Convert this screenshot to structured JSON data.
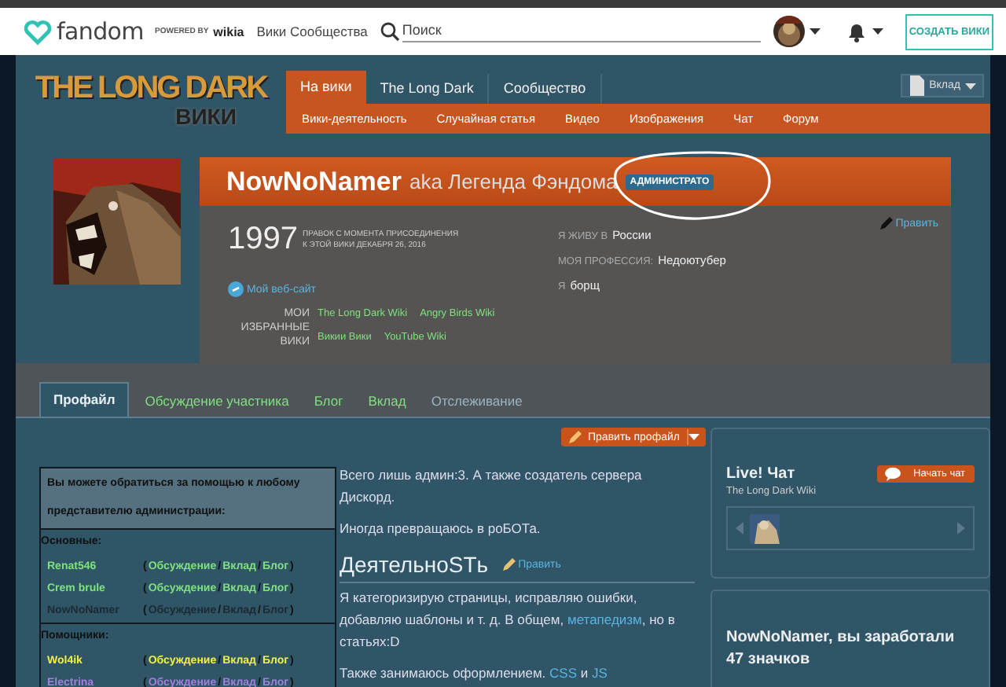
{
  "topbar": {
    "logo": "fandom",
    "powered_by": "POWERED BY",
    "wikia": "wikia",
    "community_link": "Вики Сообщества",
    "search": {
      "placeholder": "Поиск"
    },
    "create_button": "СОЗДАТЬ ВИКИ"
  },
  "wiki_header": {
    "logo_title": "THE LONG DARK",
    "logo_subtitle": "ВИКИ",
    "tabs": [
      {
        "label": "На вики",
        "selected": true
      },
      {
        "label": "The Long Dark",
        "selected": false
      },
      {
        "label": "Сообщество",
        "selected": false
      }
    ],
    "subnav": [
      "Вики-деятельность",
      "Случайная статья",
      "Видео",
      "Изображения",
      "Чат",
      "Форум"
    ],
    "contribute_button": "Вклад"
  },
  "profile": {
    "name": "NowNoNamer",
    "aka": "aka Легенда Фэндома",
    "badge": "АДМИНИСТРАТО",
    "edit_link": "Править",
    "edit_count": "1997",
    "edit_caption": [
      "ПРАВОК С МОМЕНТА ПРИСОЕДИНЕНИЯ",
      "К ЭТОЙ ВИКИ ДЕКАБРЯ 26, 2016"
    ],
    "website": "Мой веб-сайт",
    "favorites_label": "МОИ ИЗБРАННЫЕ ВИКИ",
    "favorites": [
      "The Long Dark Wiki",
      "Angry Birds Wiki",
      "Викии Вики",
      "YouTube Wiki"
    ],
    "facts": [
      {
        "label": "Я ЖИВУ В",
        "value": "России"
      },
      {
        "label": "МОЯ ПРОФЕССИЯ:",
        "value": "Недоютубер"
      },
      {
        "label": "Я",
        "value": "борщ"
      }
    ]
  },
  "tabs": [
    {
      "label": "Профайл",
      "selected": true
    },
    {
      "label": "Обсуждение участника",
      "selected": false
    },
    {
      "label": "Блог",
      "selected": false
    },
    {
      "label": "Вклад",
      "selected": false
    },
    {
      "label": "Отслеживание",
      "selected": false
    }
  ],
  "edit_profile_button": "Править профайл",
  "admin_table": {
    "header": "Вы можете обратиться за помощью к любому представителю администрации:",
    "groups": [
      {
        "title": "Основные:",
        "members": [
          {
            "name": "Renat546",
            "color": "#7ee07e",
            "parts": [
              "(",
              "Обсуждение",
              "/",
              "Вклад",
              "/",
              "Блог",
              ")"
            ]
          },
          {
            "name": "Crem brule",
            "color": "#7ee07e",
            "parts": [
              "(",
              "Обсуждение",
              "/",
              "Вклад",
              "/",
              "Блог",
              ")"
            ]
          },
          {
            "name": "NowNoNamer",
            "color": "#1c2a33",
            "parts": [
              "(",
              "Обсуждение",
              "/",
              "Вклад",
              "/",
              "Блог",
              ")"
            ]
          }
        ]
      },
      {
        "title": "Помощники:",
        "members": [
          {
            "name": "Wol4ik",
            "color": "#f2f23c",
            "parts": [
              "(",
              "Обсуждение",
              "/",
              "Вклад",
              "/",
              "Блог",
              ")"
            ]
          },
          {
            "name": "Electrina",
            "color": "#a47de0",
            "parts": [
              "(",
              "Обсуждение",
              "/",
              "Вклад",
              "/",
              "Блог",
              ")"
            ]
          }
        ]
      }
    ]
  },
  "bio": [
    {
      "kind": "p",
      "segments": [
        {
          "text": "Всего лишь админ:3. А также создатель сервера Дискорд.",
          "kind": "text"
        }
      ]
    },
    {
      "kind": "p",
      "segments": [
        {
          "text": "Иногда превращаюсь в роБОТа.",
          "kind": "text"
        }
      ]
    },
    {
      "kind": "h",
      "title": "ДеятельноSTь",
      "edit": "Править"
    },
    {
      "kind": "p",
      "segments": [
        {
          "text": "Я категоризирую страницы, исправляю ошибки, добавляю шаблоны и т. д. В общем, ",
          "kind": "text"
        },
        {
          "text": "метапедизм",
          "kind": "link"
        },
        {
          "text": ", но в статьях:D",
          "kind": "text"
        }
      ]
    },
    {
      "kind": "p",
      "segments": [
        {
          "text": "Также занимаюсь оформлением. ",
          "kind": "text"
        },
        {
          "text": "CSS",
          "kind": "link"
        },
        {
          "text": " и ",
          "kind": "text"
        },
        {
          "text": "JS",
          "kind": "link"
        }
      ]
    }
  ],
  "chat": {
    "title": "Live! Чат",
    "subtitle": "The Long Dark Wiki",
    "button": "Начать чат"
  },
  "badges": {
    "title": "NowNoNamer, вы заработали 47 значков"
  }
}
